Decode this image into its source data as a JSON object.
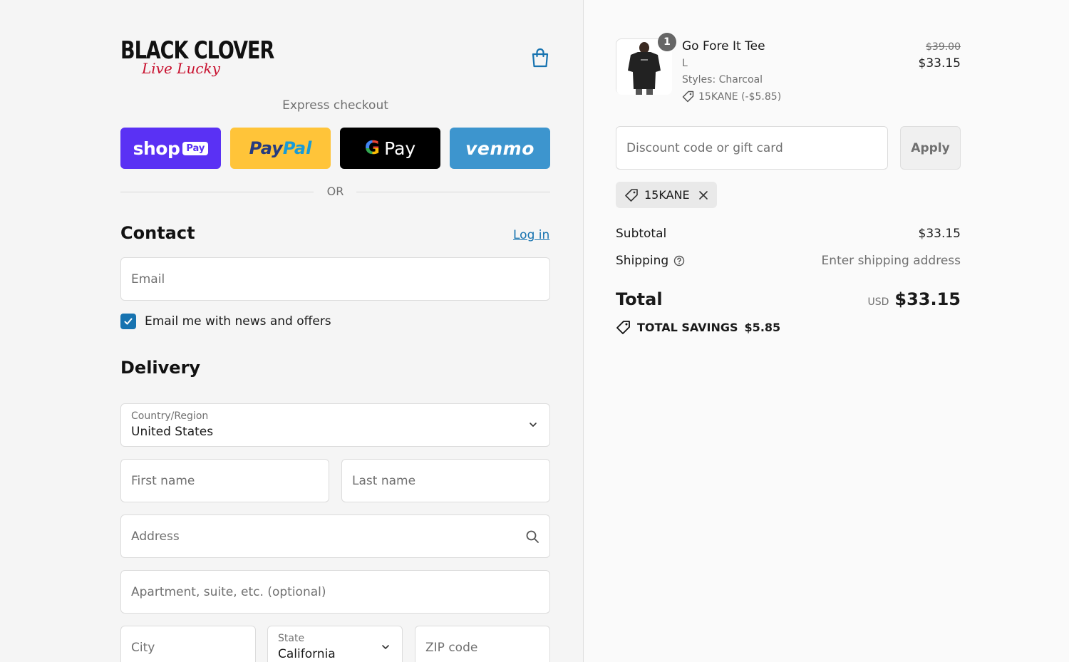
{
  "brand": {
    "name": "BLACK CLOVER",
    "tagline": "Live Lucky"
  },
  "express": {
    "label": "Express checkout",
    "buttons": [
      {
        "id": "shop",
        "text": "shop",
        "chip": "Pay",
        "color": "#5a31f4"
      },
      {
        "id": "paypal",
        "text_a": "Pay",
        "text_b": "Pal",
        "color": "#ffc439"
      },
      {
        "id": "gpay",
        "g": "G",
        "text": "Pay",
        "color": "#000000"
      },
      {
        "id": "venmo",
        "text": "venmo",
        "color": "#3d95ce"
      }
    ],
    "divider": "OR"
  },
  "contact": {
    "heading": "Contact",
    "login": "Log in",
    "email_placeholder": "Email",
    "newsletter_label": "Email me with news and offers",
    "newsletter_checked": true
  },
  "delivery": {
    "heading": "Delivery",
    "country_label": "Country/Region",
    "country_value": "United States",
    "first_name_placeholder": "First name",
    "last_name_placeholder": "Last name",
    "address_placeholder": "Address",
    "apartment_placeholder": "Apartment, suite, etc. (optional)",
    "city_placeholder": "City",
    "state_label": "State",
    "state_value": "California",
    "zip_placeholder": "ZIP code"
  },
  "order": {
    "item": {
      "quantity": "1",
      "name": "Go Fore It Tee",
      "size": "L",
      "style": "Styles: Charcoal",
      "discount": "15KANE (-$5.85)",
      "price_original": "$39.00",
      "price_final": "$33.15"
    },
    "discount_placeholder": "Discount code or gift card",
    "apply_label": "Apply",
    "applied_code": "15KANE",
    "subtotal_label": "Subtotal",
    "subtotal_value": "$33.15",
    "shipping_label": "Shipping",
    "shipping_value": "Enter shipping address",
    "total_label": "Total",
    "total_currency": "USD",
    "total_value": "$33.15",
    "savings_label": "TOTAL SAVINGS",
    "savings_value": "$5.85"
  },
  "colors": {
    "accent": "#1773b0",
    "brand_red": "#c8102e"
  }
}
